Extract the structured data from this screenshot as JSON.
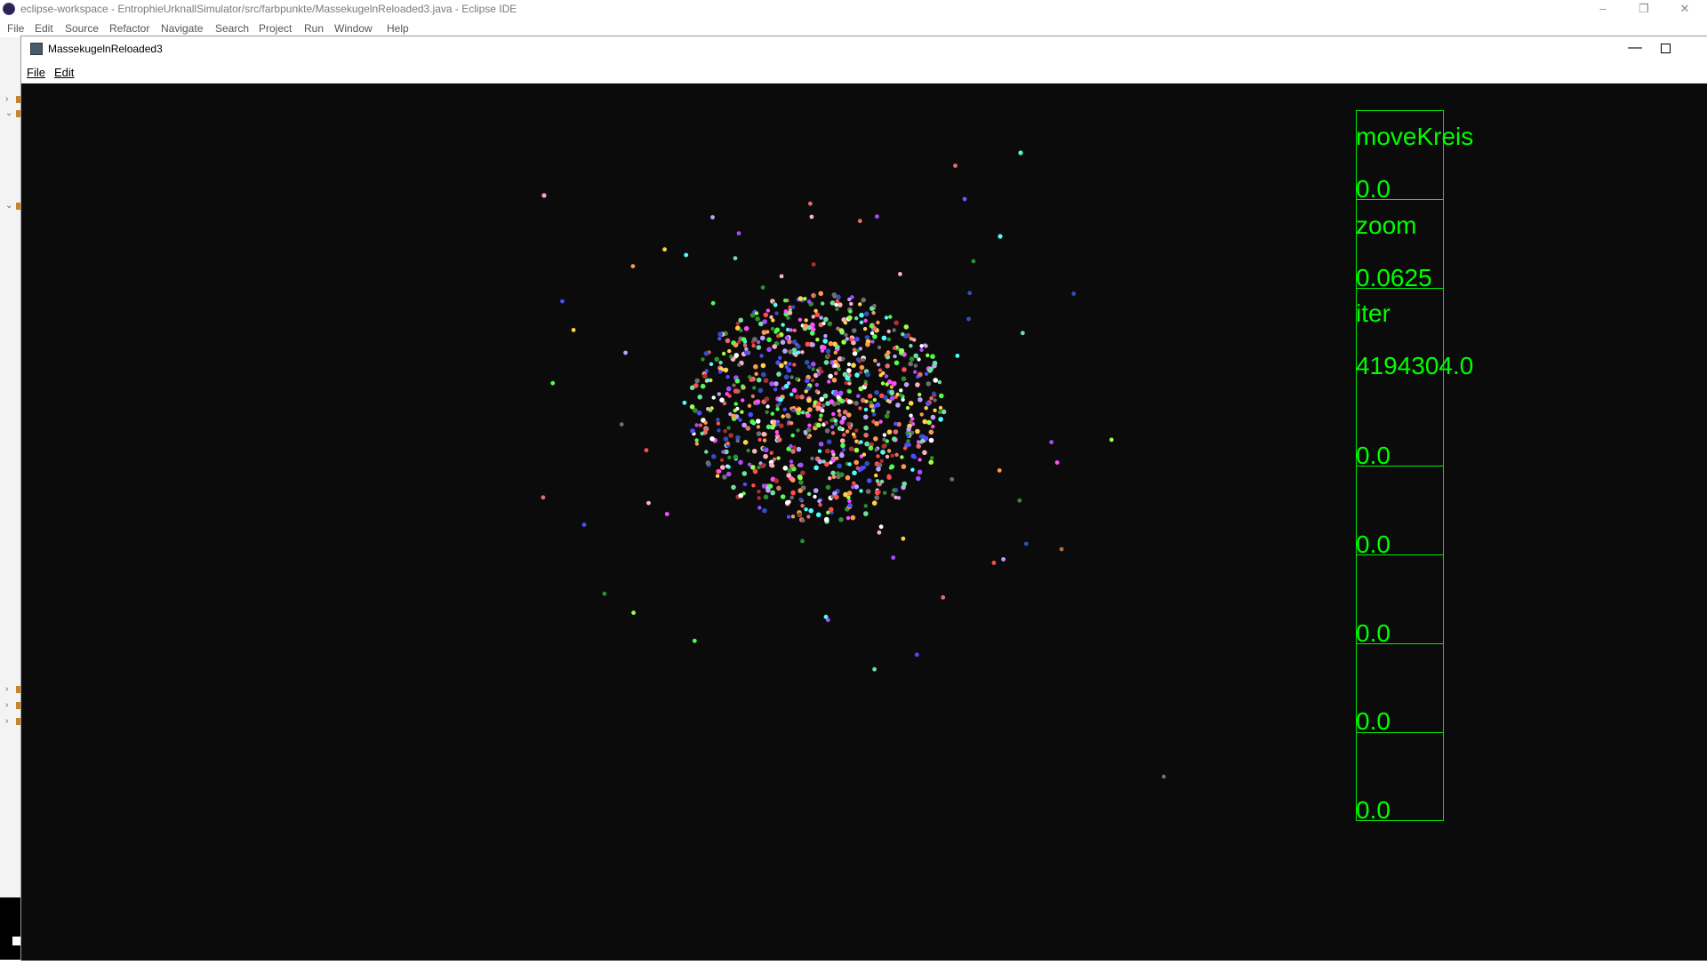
{
  "eclipse": {
    "title": "eclipse-workspace - EntrophieUrknallSimulator/src/farbpunkte/MassekugelnReloaded3.java - Eclipse IDE",
    "menu": [
      "File",
      "Edit",
      "Source",
      "Refactor",
      "Navigate",
      "Search",
      "Project",
      "Run",
      "Window",
      "Help"
    ],
    "window_controls": {
      "minimize": "–",
      "restore": "❐",
      "close": "✕"
    }
  },
  "app": {
    "title": "MassekugelnReloaded3",
    "menu": [
      "File",
      "Edit"
    ],
    "controls": {
      "minimize": "—"
    }
  },
  "stats": {
    "labels": [
      "moveKreis",
      "zoom",
      "iter"
    ],
    "values": [
      "0.0",
      "0.0625",
      "4194304.0",
      "0.0",
      "0.0",
      "0.0",
      "0.0",
      "0.0"
    ]
  },
  "colors": {
    "canvas_background": "#0b0b0b",
    "stats_green": "#00ff00"
  }
}
